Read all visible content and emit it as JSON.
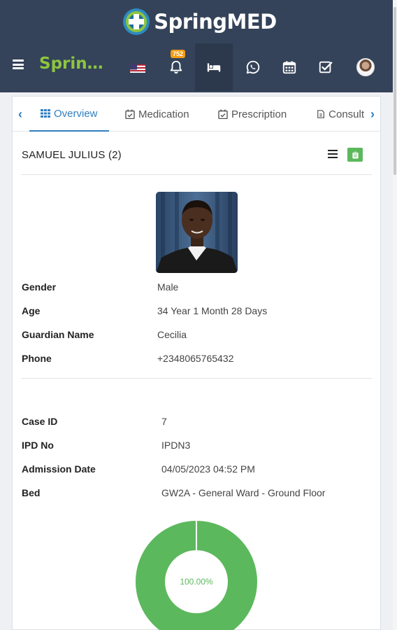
{
  "brand": {
    "name": "SpringMED"
  },
  "nav": {
    "title": "Sprin…",
    "notification_count": "752"
  },
  "tabs": [
    {
      "label": "Overview",
      "active": true
    },
    {
      "label": "Medication",
      "active": false
    },
    {
      "label": "Prescription",
      "active": false
    },
    {
      "label": "Consult",
      "active": false
    }
  ],
  "patient": {
    "name": "SAMUEL JULIUS (2)",
    "details": [
      {
        "label": "Gender",
        "value": "Male"
      },
      {
        "label": "Age",
        "value": "34 Year 1 Month 28 Days"
      },
      {
        "label": "Guardian Name",
        "value": "Cecilia"
      },
      {
        "label": "Phone",
        "value": "+2348065765432"
      }
    ]
  },
  "admission": {
    "details": [
      {
        "label": "Case ID",
        "value": "7"
      },
      {
        "label": "IPD No",
        "value": "IPDN3"
      },
      {
        "label": "Admission Date",
        "value": "04/05/2023 04:52 PM"
      },
      {
        "label": "Bed",
        "value": "GW2A - General Ward - Ground Floor"
      }
    ]
  },
  "donut": {
    "label": "100.00%",
    "percent": 100
  },
  "colors": {
    "header_bg": "#344359",
    "brand_green": "#8dc63f",
    "accent_blue": "#2f7fc1",
    "success_green": "#5cb85c",
    "badge_orange": "#f39c12"
  },
  "icons": {
    "menu": "hamburger-icon",
    "language": "us-flag-icon",
    "notifications": "bell-icon",
    "beds": "bed-icon",
    "whatsapp": "whatsapp-icon",
    "calendar": "calendar-icon",
    "tasks": "checkbox-icon",
    "profile": "user-avatar"
  }
}
